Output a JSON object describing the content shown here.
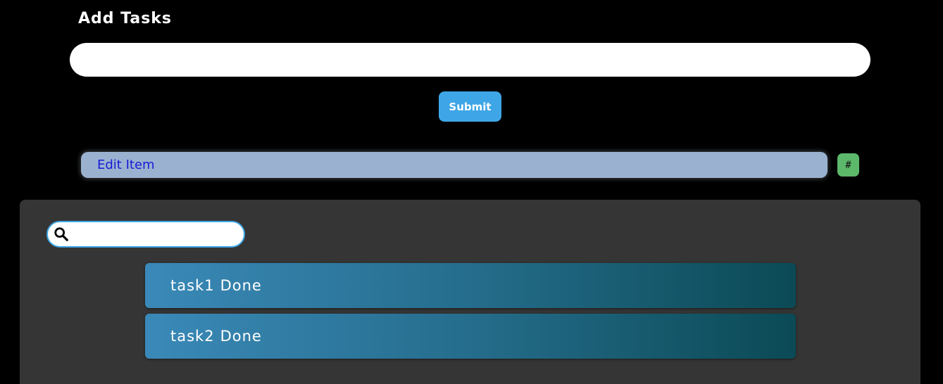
{
  "header": {
    "title": "Add Tasks"
  },
  "add_form": {
    "input_value": "",
    "submit_label": "Submit"
  },
  "edit_form": {
    "input_value": "Edit Item",
    "hash_label": "#"
  },
  "search": {
    "value": ""
  },
  "tasks": [
    {
      "name": "task1",
      "status": "Done"
    },
    {
      "name": "task2",
      "status": "Done"
    }
  ],
  "colors": {
    "accent": "#3ea6e6",
    "edit_bg": "#9ab2d0",
    "edit_text": "#1a1ad6",
    "hash_bg": "#5cb86a",
    "panel_bg": "#353535"
  }
}
